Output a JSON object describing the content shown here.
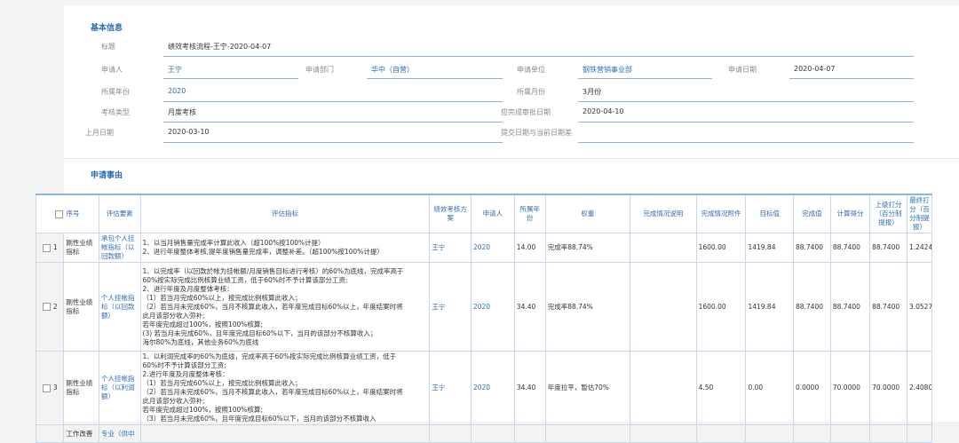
{
  "basic": {
    "title": "基本信息",
    "fields": {
      "title_label": "标题",
      "title_value": "绩效考核流程-王宁-2020-04-07",
      "applicant_label": "申请人",
      "applicant_value": "王宁",
      "dept_label": "申请部门",
      "dept_value": "华中（自营）",
      "unit_label": "申请单位",
      "unit_value": "钢铁营销事业部",
      "date_label": "申请日期",
      "date_value": "2020-04-07",
      "year_label": "所属年份",
      "year_value": "2020",
      "month_label": "所属月份",
      "month_value": "3月份",
      "type_label": "考核类型",
      "type_value": "月度考核",
      "deadline_label": "应完成审批日期",
      "deadline_value": "2020-04-10",
      "lastmonth_label": "上月日期",
      "lastmonth_value": "2020-03-10",
      "diff_label": "提交日期与当前日期差",
      "diff_value": ""
    }
  },
  "request": {
    "title": "申请事由",
    "headers": {
      "seq": "序号",
      "element": "评估要素",
      "indicator": "评估指标",
      "plan": "绩效考核方案",
      "applicant": "申请人",
      "year": "所属年份",
      "weight": "权重",
      "desc": "完成情况说明",
      "attach": "完成情况附件",
      "target": "目标值",
      "actual": "完成值",
      "score": "计算得分",
      "upper": "上级打分（百分制提报）",
      "final": "最终打分（百分制提报）",
      "final_ten": "最终打十分制"
    },
    "rows": [
      {
        "seq": "1",
        "element": "刚性业绩指标",
        "indicator": "承包个人挂帐指标（以回款额）",
        "plan": [
          "1、以当月销售量完成率计算此收入（超100%按100%计提）",
          "2、进行年度整体考核,提年度销售量完成率，调整补差。（超100%按100%计提）"
        ],
        "applicant": "王宁",
        "year": "2020",
        "weight": "14.00",
        "desc": "完成率88.74%",
        "attach": "",
        "target": "1600.00",
        "actual": "1419.84",
        "score": "88.7400",
        "upper": "88.7400",
        "final": "88.7400",
        "final_ten": "1.2424"
      },
      {
        "seq": "2",
        "element": "刚性业绩指标",
        "indicator": "个人挂帐指标（以回款额）",
        "plan": [
          "1、以完成率（以回款於帐为挂帐额/月度销售目标进行考核）的60%为底线，完成率高于",
          "60%按实际完成比例核算业绩工资，低于60%时不予计算该部分工资;",
          "2、进行年度及月度整体考核：",
          "（1）若当月完成60%以上，按完成比例核算此收入；",
          "（2）若当月未完成60%，当月不核算此收入，若年度完成目标60%以上，年度结案时将",
          "此月该部分收入弥补;",
          "若年度完成超过100%，按照100%核算;",
          "(3) 若当月未完成60%，且年度完成目标60%以下，当月的该部分不核算收入；",
          "海尔80%为底线，其他业务60%为底线"
        ],
        "applicant": "王宁",
        "year": "2020",
        "weight": "34.40",
        "desc": "完成率88.74%",
        "attach": "",
        "target": "1600.00",
        "actual": "1419.84",
        "score": "88.7400",
        "upper": "88.7400",
        "final": "88.7400",
        "final_ten": "3.0527"
      },
      {
        "seq": "3",
        "element": "刚性业绩指标",
        "indicator": "个人挂帐指标（以利润额）",
        "plan": [
          "1、以利润完成率的60%为底线，完成率高于60%按实际完成比例核算业绩工资，低于",
          "60%时不予计算该部分工资;",
          "2.进行年度及月度整体考核：",
          "（1）若当月完成60%以上，按完成比例核算此收入；",
          "（2）若当月未完成60%，当月不核算此收入，若年度完成目标60%以上，年度结案时将",
          "此月该部分收入弥补;",
          "若年度完成超过100%，按照100%核算;",
          "（3）若当月未完成60%，且年度完成目标60%以下，当月的该部分不核算收入"
        ],
        "applicant": "王宁",
        "year": "2020",
        "weight": "34.40",
        "desc": "年度拉平，暂估70%",
        "attach": "",
        "target": "4.50",
        "actual": "0.00",
        "score": "0.0000",
        "upper": "70.0000",
        "final": "70.0000",
        "final_ten": "2.4080"
      }
    ],
    "partial_row": {
      "element": "工作改善",
      "indicator": "专业（供中"
    }
  }
}
